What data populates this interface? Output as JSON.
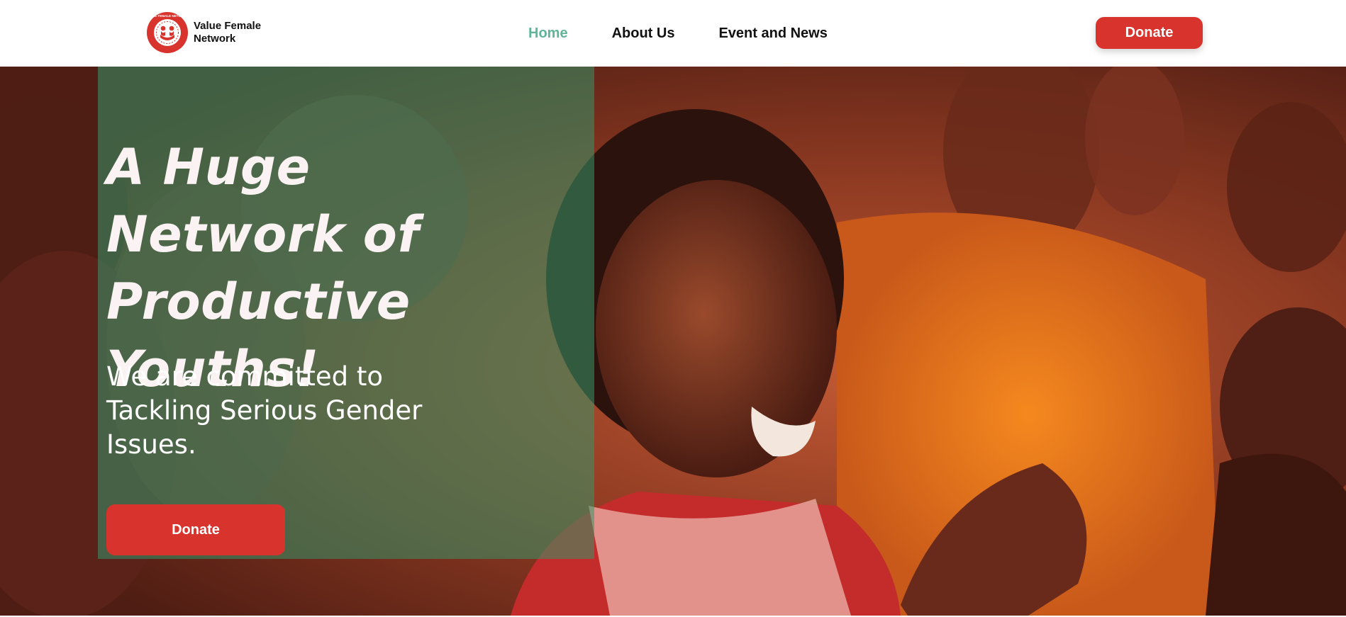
{
  "header": {
    "logo_text": "Value Female Network",
    "logo_ring_text": "VALUE FEMALE NETWORK",
    "nav": [
      {
        "label": "Home",
        "active": true
      },
      {
        "label": "About Us",
        "active": false
      },
      {
        "label": "Event and News",
        "active": false
      }
    ],
    "donate_label": "Donate"
  },
  "hero": {
    "title": "A Huge Network of Productive Youths!",
    "subtitle": "We are committed to Tackling Serious Gender Issues.",
    "donate_label": "Donate",
    "image_icon": "smiling-girl-clapping-photo"
  },
  "colors": {
    "accent_green": "#5fb597",
    "brand_red": "#d9332d",
    "overlay_green": "#379669"
  }
}
